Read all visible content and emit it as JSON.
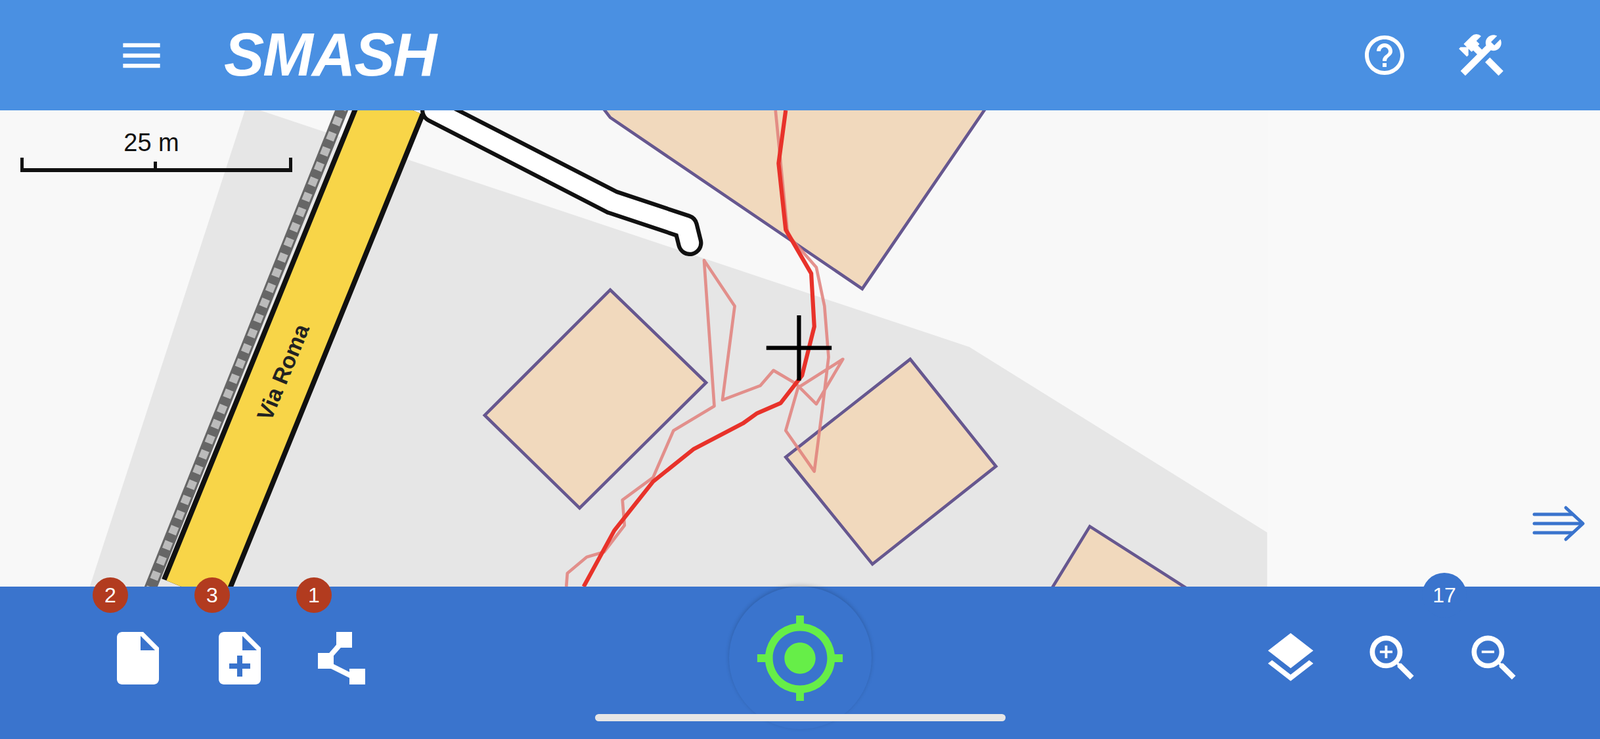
{
  "app_bar": {
    "title": "SMASH"
  },
  "map": {
    "scale_bar": {
      "label": "25 m"
    },
    "streets": [
      {
        "name": "Via Roma"
      }
    ]
  },
  "toolbar": {
    "left_buttons": [
      {
        "kind": "notes",
        "badge": "2"
      },
      {
        "kind": "add-note",
        "badge": "3"
      },
      {
        "kind": "logs",
        "badge": "1"
      }
    ],
    "gps": {
      "active": true
    },
    "zoom": {
      "level": "17"
    }
  }
}
